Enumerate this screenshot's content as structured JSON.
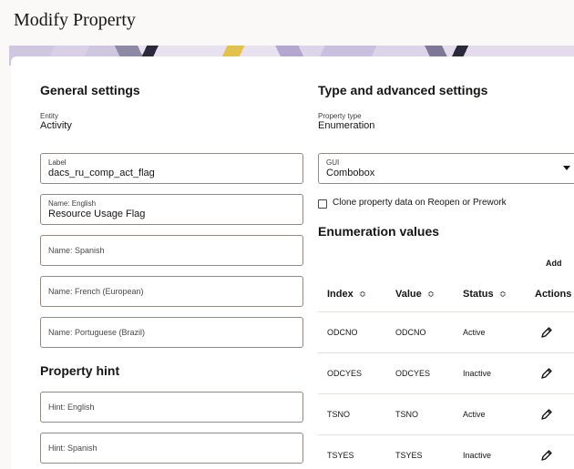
{
  "page": {
    "title": "Modify Property"
  },
  "general": {
    "heading": "General settings",
    "entity_caption": "Entity",
    "entity_value": "Activity",
    "fields": [
      {
        "label": "Label",
        "value": "dacs_ru_comp_act_flag"
      },
      {
        "label": "Name: English",
        "value": "Resource Usage Flag"
      },
      {
        "placeholder": "Name: Spanish"
      },
      {
        "placeholder": "Name: French (European)"
      },
      {
        "placeholder": "Name: Portuguese (Brazil)"
      }
    ]
  },
  "hint": {
    "heading": "Property hint",
    "fields": [
      {
        "placeholder": "Hint: English"
      },
      {
        "placeholder": "Hint: Spanish"
      }
    ]
  },
  "advanced": {
    "heading": "Type and advanced settings",
    "type_caption": "Property type",
    "type_value": "Enumeration",
    "gui_label": "GUI",
    "gui_value": "Combobox",
    "clone_label": "Clone property data on Reopen or Prework"
  },
  "enumeration": {
    "heading": "Enumeration values",
    "add_label": "Add",
    "columns": [
      "Index",
      "Value",
      "Status",
      "Actions"
    ],
    "sort_glyph": "≎",
    "rows": [
      {
        "index": "ODCNO",
        "value": "ODCNO",
        "status": "Active"
      },
      {
        "index": "ODCYES",
        "value": "ODCYES",
        "status": "Inactive"
      },
      {
        "index": "TSNO",
        "value": "TSNO",
        "status": "Active"
      },
      {
        "index": "TSYES",
        "value": "TSYES",
        "status": "Inactive"
      }
    ],
    "action_icon": "pencil-icon"
  }
}
